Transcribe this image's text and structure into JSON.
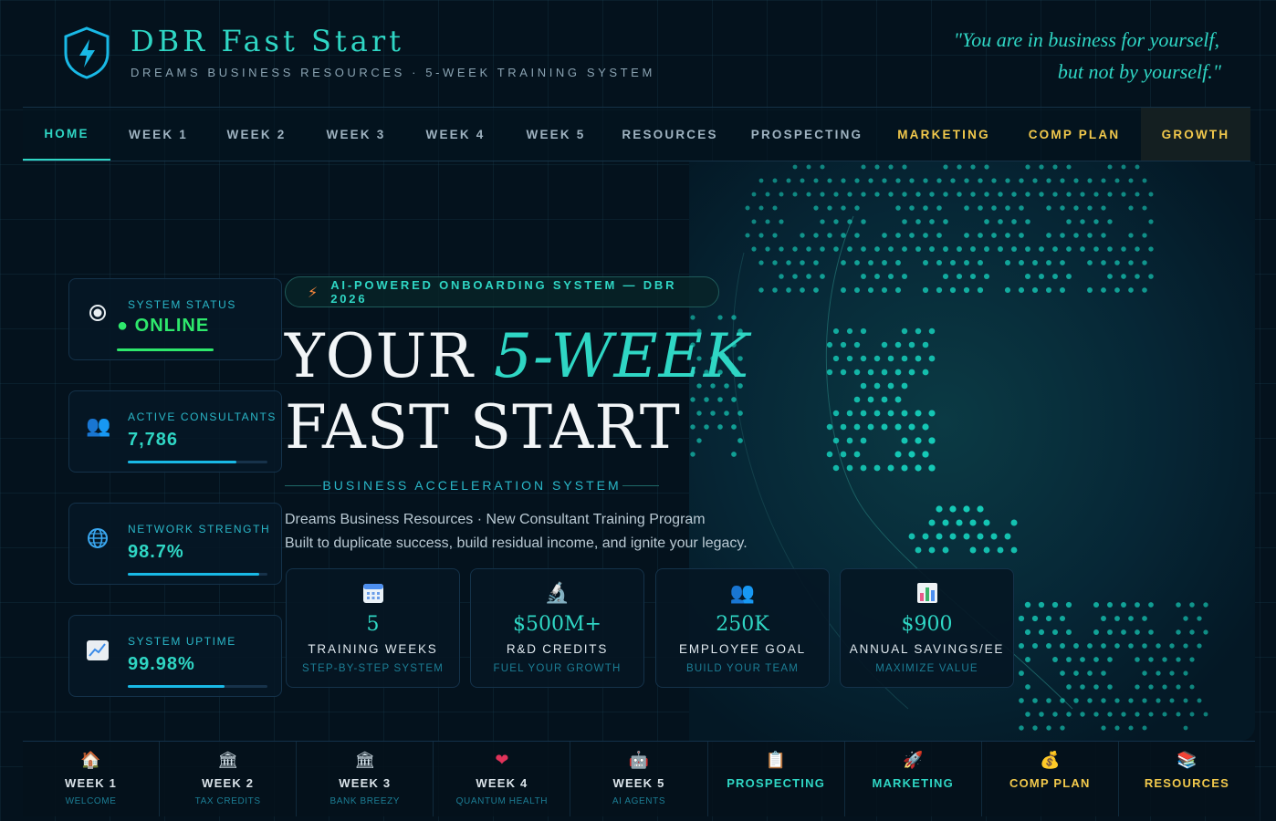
{
  "header": {
    "title": "DBR Fast Start",
    "subtitle": "DREAMS BUSINESS RESOURCES · 5-WEEK TRAINING SYSTEM",
    "quote_line1": "\"You are in business for yourself,",
    "quote_line2": "but not by yourself.\""
  },
  "nav": {
    "items": [
      {
        "label": "HOME"
      },
      {
        "label": "WEEK 1"
      },
      {
        "label": "WEEK 2"
      },
      {
        "label": "WEEK 3"
      },
      {
        "label": "WEEK 4"
      },
      {
        "label": "WEEK 5"
      },
      {
        "label": "RESOURCES"
      },
      {
        "label": "PROSPECTING"
      },
      {
        "label": "MARKETING"
      },
      {
        "label": "COMP PLAN"
      },
      {
        "label": "GROWTH"
      }
    ],
    "active": "HOME"
  },
  "stats": [
    {
      "label": "SYSTEM STATUS",
      "value": "ONLINE",
      "icon": "radio-icon"
    },
    {
      "label": "ACTIVE CONSULTANTS",
      "value": "7,786",
      "icon": "users-icon",
      "fill": 0.78
    },
    {
      "label": "NETWORK STRENGTH",
      "value": "98.7%",
      "icon": "globe-icon",
      "fill": 0.94
    },
    {
      "label": "SYSTEM UPTIME",
      "value": "99.98%",
      "icon": "chart-icon",
      "fill": 0.69
    }
  ],
  "hero": {
    "badge": "AI-POWERED ONBOARDING SYSTEM — DBR 2026",
    "title_line1_a": "YOUR ",
    "title_line1_b": "5-WEEK",
    "title_line2": "FAST START",
    "subtitle": "BUSINESS ACCELERATION SYSTEM",
    "desc_line1": "Dreams Business Resources · New Consultant Training Program",
    "desc_line2": "Built to duplicate success, build residual income, and ignite your legacy."
  },
  "metrics": [
    {
      "value": "5",
      "label": "TRAINING WEEKS",
      "sub": "STEP-BY-STEP SYSTEM",
      "icon": "calendar-icon"
    },
    {
      "value": "$500M+",
      "label": "R&D CREDITS",
      "sub": "FUEL YOUR GROWTH",
      "icon": "microscope-icon"
    },
    {
      "value": "250K",
      "label": "EMPLOYEE GOAL",
      "sub": "BUILD YOUR TEAM",
      "icon": "users-icon"
    },
    {
      "value": "$900",
      "label": "ANNUAL SAVINGS/EE",
      "sub": "MAXIMIZE VALUE",
      "icon": "bar-chart-icon"
    }
  ],
  "bottom": [
    {
      "label": "WEEK 1",
      "sub": "WELCOME",
      "icon": "house-icon"
    },
    {
      "label": "WEEK 2",
      "sub": "TAX CREDITS",
      "icon": "bank-icon"
    },
    {
      "label": "WEEK 3",
      "sub": "BANK BREEZY",
      "icon": "bank-icon"
    },
    {
      "label": "WEEK 4",
      "sub": "QUANTUM HEALTH",
      "icon": "heart-icon"
    },
    {
      "label": "WEEK 5",
      "sub": "AI AGENTS",
      "icon": "robot-icon"
    },
    {
      "label": "PROSPECTING",
      "sub": "",
      "icon": "clipboard-icon"
    },
    {
      "label": "MARKETING",
      "sub": "",
      "icon": "rocket-icon"
    },
    {
      "label": "COMP PLAN",
      "sub": "",
      "icon": "money-bag-icon"
    },
    {
      "label": "RESOURCES",
      "sub": "",
      "icon": "books-icon"
    }
  ],
  "colors": {
    "accent": "#2fd6c4",
    "gold": "#f2c94c",
    "online": "#2ee86c",
    "background": "#04121d"
  }
}
